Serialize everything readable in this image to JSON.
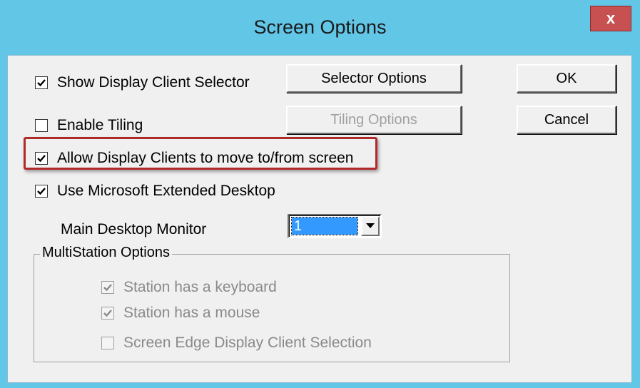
{
  "window": {
    "title": "Screen Options",
    "close_label": "x"
  },
  "checkboxes": {
    "show_selector": {
      "label": "Show Display Client Selector",
      "checked": true
    },
    "enable_tiling": {
      "label": "Enable Tiling",
      "checked": false
    },
    "allow_move": {
      "label": "Allow Display Clients to move to/from screen",
      "checked": true
    },
    "use_extended": {
      "label": "Use Microsoft Extended Desktop",
      "checked": true
    }
  },
  "buttons": {
    "selector_options": "Selector Options",
    "tiling_options": "Tiling Options",
    "ok": "OK",
    "cancel": "Cancel"
  },
  "main_monitor": {
    "label": "Main Desktop Monitor",
    "value": "1"
  },
  "multistation": {
    "title": "MultiStation Options",
    "keyboard": {
      "label": "Station has a keyboard",
      "checked": true
    },
    "mouse": {
      "label": "Station has a mouse",
      "checked": true
    },
    "edge": {
      "label": "Screen Edge Display Client Selection",
      "checked": false
    }
  },
  "colors": {
    "titlebar": "#62c6e7",
    "close": "#c75050",
    "highlight": "#b02a2a",
    "selection": "#3399ff"
  }
}
